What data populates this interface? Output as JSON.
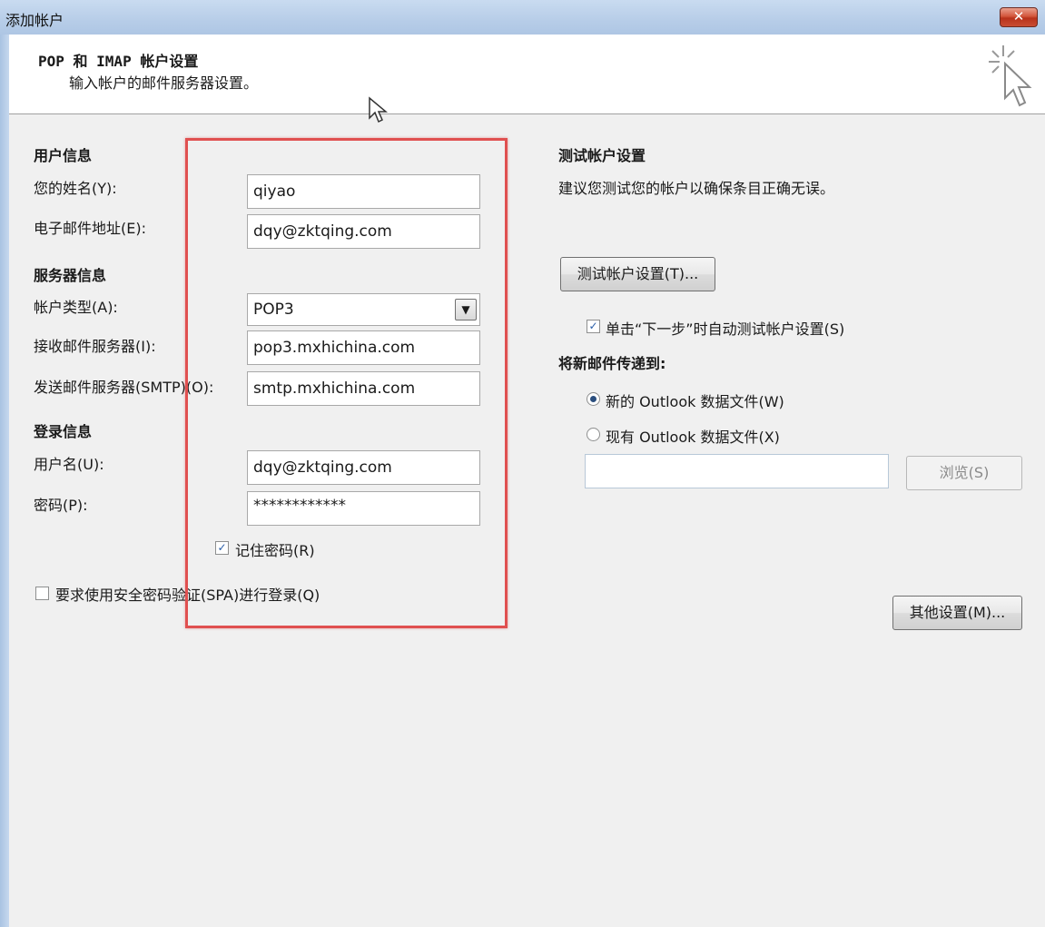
{
  "window": {
    "title": "添加帐户",
    "close_glyph": "✕"
  },
  "header": {
    "title": "POP 和 IMAP 帐户设置",
    "subtitle": "输入帐户的邮件服务器设置。",
    "icon": "wizard-cursor-icon"
  },
  "user_info": {
    "heading": "用户信息",
    "name_label": "您的姓名(Y):",
    "name_value": "qiyao",
    "email_label": "电子邮件地址(E):",
    "email_value": "dqy@zktqing.com"
  },
  "server_info": {
    "heading": "服务器信息",
    "account_type_label": "帐户类型(A):",
    "account_type_value": "POP3",
    "incoming_label": "接收邮件服务器(I):",
    "incoming_value": "pop3.mxhichina.com",
    "outgoing_label": "发送邮件服务器(SMTP)(O):",
    "outgoing_value": "smtp.mxhichina.com"
  },
  "login_info": {
    "heading": "登录信息",
    "username_label": "用户名(U):",
    "username_value": "dqy@zktqing.com",
    "password_label": "密码(P):",
    "password_value": "************",
    "remember_label": "记住密码(R)",
    "remember_checked": true,
    "spa_label": "要求使用安全密码验证(SPA)进行登录(Q)",
    "spa_checked": false
  },
  "test_settings": {
    "heading": "测试帐户设置",
    "description": "建议您测试您的帐户以确保条目正确无误。",
    "test_button": "测试帐户设置(T)...",
    "auto_test_label": "单击“下一步”时自动测试帐户设置(S)",
    "auto_test_checked": true
  },
  "deliver": {
    "heading": "将新邮件传递到:",
    "new_file_label": "新的 Outlook 数据文件(W)",
    "existing_file_label": "现有 Outlook 数据文件(X)",
    "browse_button": "浏览(S)",
    "path_value": ""
  },
  "more_settings_button": "其他设置(M)...",
  "colors": {
    "highlight_box": "#e05050",
    "title_bar": "#b7cde8"
  }
}
